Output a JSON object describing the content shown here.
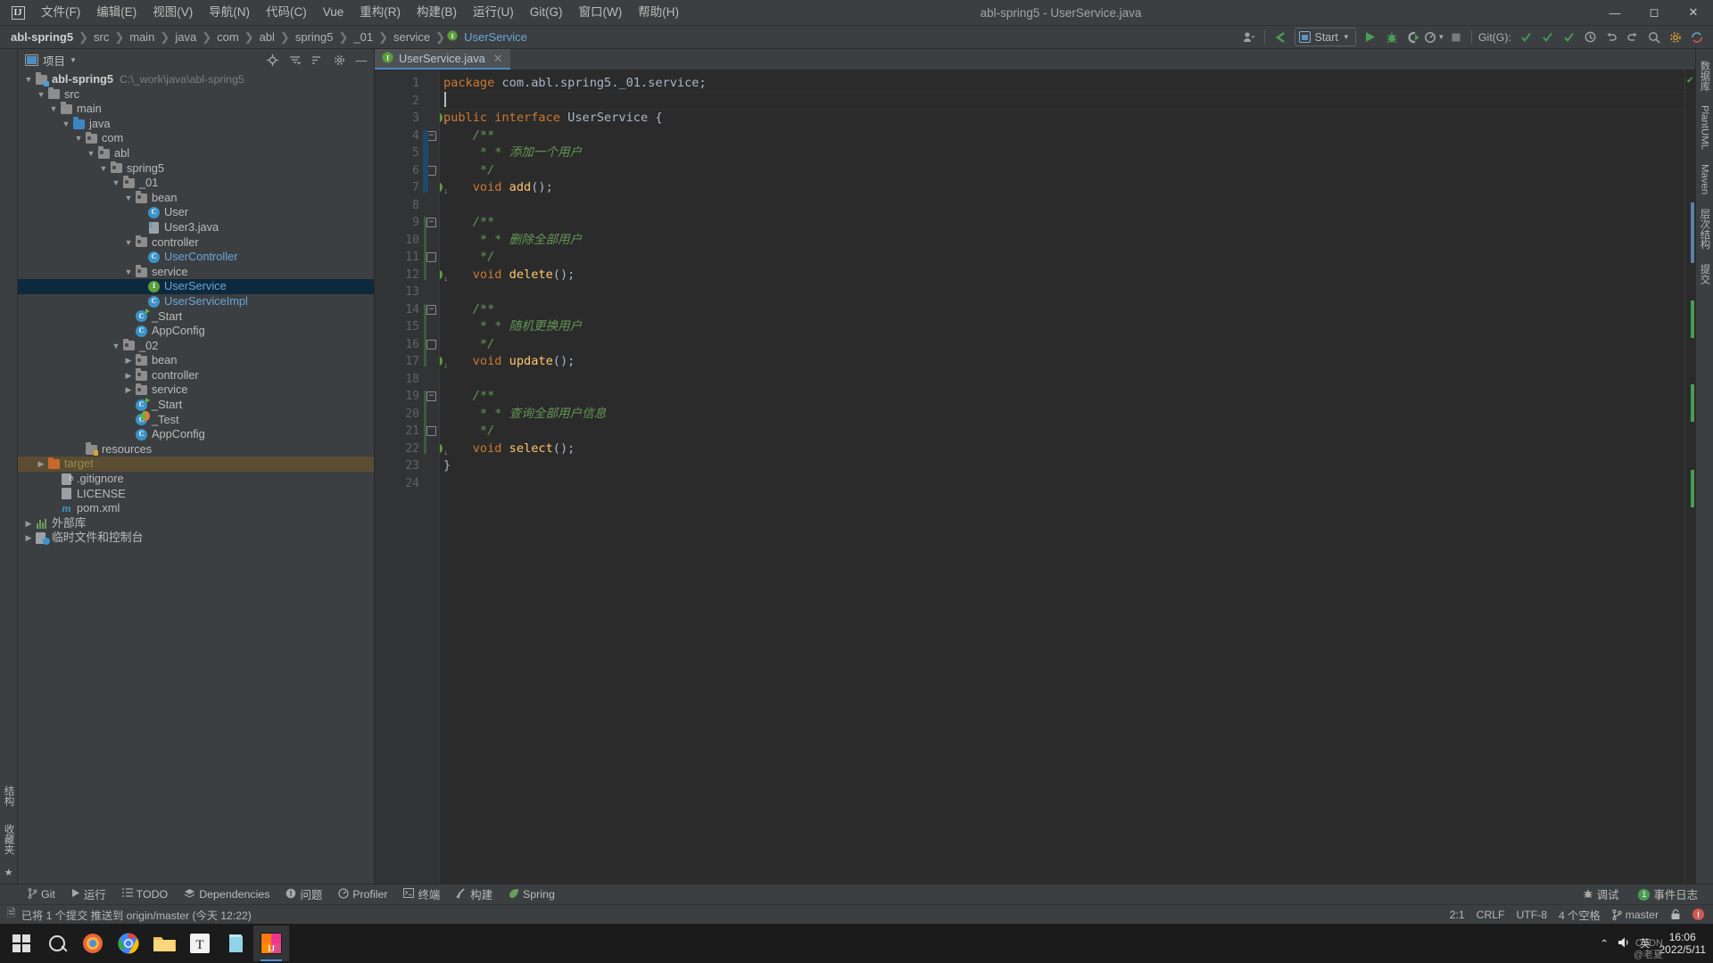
{
  "window": {
    "title": "abl-spring5 - UserService.java",
    "logo": "IJ",
    "controls": [
      "minimize",
      "maximize",
      "close"
    ]
  },
  "menu": {
    "items": [
      {
        "label": "文件(F)",
        "name": "menu-file"
      },
      {
        "label": "编辑(E)",
        "name": "menu-edit"
      },
      {
        "label": "视图(V)",
        "name": "menu-view"
      },
      {
        "label": "导航(N)",
        "name": "menu-navigate"
      },
      {
        "label": "代码(C)",
        "name": "menu-code"
      },
      {
        "label": "Vue",
        "name": "menu-vue"
      },
      {
        "label": "重构(R)",
        "name": "menu-refactor"
      },
      {
        "label": "构建(B)",
        "name": "menu-build"
      },
      {
        "label": "运行(U)",
        "name": "menu-run"
      },
      {
        "label": "Git(G)",
        "name": "menu-git"
      },
      {
        "label": "窗口(W)",
        "name": "menu-window"
      },
      {
        "label": "帮助(H)",
        "name": "menu-help"
      }
    ]
  },
  "breadcrumb": {
    "items": [
      {
        "label": "abl-spring5",
        "bold": true
      },
      {
        "label": "src",
        "bold": false
      },
      {
        "label": "main",
        "bold": false
      },
      {
        "label": "java",
        "bold": false
      },
      {
        "label": "com",
        "bold": false
      },
      {
        "label": "abl",
        "bold": false
      },
      {
        "label": "spring5",
        "bold": false
      },
      {
        "label": "_01",
        "bold": false
      },
      {
        "label": "service",
        "bold": false
      },
      {
        "label": "UserService",
        "bold": false
      }
    ],
    "separator": "❯"
  },
  "toolbar": {
    "run_config": "Start",
    "git_label": "Git(G):",
    "icons": [
      "user-avatar-icon",
      "checkmark-arrow-icon",
      "run-icon",
      "debug-icon",
      "run-with-coverage-icon",
      "profile-icon",
      "stop-icon",
      "git-update-icon",
      "git-commit-icon",
      "git-push-icon",
      "history-icon",
      "undo-icon",
      "redo-icon",
      "search-icon",
      "settings-icon",
      "help-icon"
    ]
  },
  "left_strip": {
    "tabs": [
      {
        "label": "结构",
        "name": "tool-structure",
        "active": false
      },
      {
        "label": "收藏夹",
        "name": "tool-favorites",
        "active": false
      }
    ]
  },
  "project_panel": {
    "title": "项目",
    "header_icons": [
      "locate-icon",
      "collapse-all-icon",
      "sort-icon",
      "settings-icon",
      "hide-icon"
    ],
    "tree": [
      {
        "indent": 0,
        "arrow": "down",
        "icon": "module-folder",
        "label": "abl-spring5",
        "bold": true,
        "hint": "C:\\_work\\java\\abl-spring5"
      },
      {
        "indent": 1,
        "arrow": "down",
        "icon": "folder",
        "label": "src"
      },
      {
        "indent": 2,
        "arrow": "down",
        "icon": "folder",
        "label": "main"
      },
      {
        "indent": 3,
        "arrow": "down",
        "icon": "folder-blue",
        "label": "java"
      },
      {
        "indent": 4,
        "arrow": "down",
        "icon": "package",
        "label": "com"
      },
      {
        "indent": 5,
        "arrow": "down",
        "icon": "package",
        "label": "abl"
      },
      {
        "indent": 6,
        "arrow": "down",
        "icon": "package",
        "label": "spring5"
      },
      {
        "indent": 7,
        "arrow": "down",
        "icon": "package",
        "label": "_01"
      },
      {
        "indent": 8,
        "arrow": "down",
        "icon": "package",
        "label": "bean"
      },
      {
        "indent": 9,
        "arrow": "none",
        "icon": "class",
        "label": "User"
      },
      {
        "indent": 9,
        "arrow": "none",
        "icon": "java-file",
        "label": "User3.java"
      },
      {
        "indent": 8,
        "arrow": "down",
        "icon": "package",
        "label": "controller"
      },
      {
        "indent": 9,
        "arrow": "none",
        "icon": "class",
        "label": "UserController",
        "color": "blue"
      },
      {
        "indent": 8,
        "arrow": "down",
        "icon": "package",
        "label": "service"
      },
      {
        "indent": 9,
        "arrow": "none",
        "icon": "interface",
        "label": "UserService",
        "color": "blue",
        "selected": true
      },
      {
        "indent": 9,
        "arrow": "none",
        "icon": "class",
        "label": "UserServiceImpl",
        "color": "blue"
      },
      {
        "indent": 8,
        "arrow": "none",
        "icon": "class-runnable",
        "label": "_Start"
      },
      {
        "indent": 8,
        "arrow": "none",
        "icon": "class",
        "label": "AppConfig"
      },
      {
        "indent": 7,
        "arrow": "down",
        "icon": "package",
        "label": "_02"
      },
      {
        "indent": 8,
        "arrow": "right",
        "icon": "package",
        "label": "bean"
      },
      {
        "indent": 8,
        "arrow": "right",
        "icon": "package",
        "label": "controller"
      },
      {
        "indent": 8,
        "arrow": "right",
        "icon": "package",
        "label": "service"
      },
      {
        "indent": 8,
        "arrow": "none",
        "icon": "class-runnable",
        "label": "_Start"
      },
      {
        "indent": 8,
        "arrow": "none",
        "icon": "class-test",
        "label": "_Test"
      },
      {
        "indent": 8,
        "arrow": "none",
        "icon": "class",
        "label": "AppConfig"
      },
      {
        "indent": 4,
        "arrow": "none",
        "icon": "folder-resource",
        "label": "resources"
      },
      {
        "indent": 1,
        "arrow": "right",
        "icon": "folder-orange",
        "label": "target",
        "color": "orange",
        "highlight": true
      },
      {
        "indent": 2,
        "arrow": "none",
        "icon": "gitignore-file",
        "label": ".gitignore"
      },
      {
        "indent": 2,
        "arrow": "none",
        "icon": "text-file",
        "label": "LICENSE"
      },
      {
        "indent": 2,
        "arrow": "none",
        "icon": "maven-file",
        "label": "pom.xml"
      },
      {
        "indent": 0,
        "arrow": "right",
        "icon": "library",
        "label": "外部库"
      },
      {
        "indent": 0,
        "arrow": "right",
        "icon": "scratches",
        "label": "临时文件和控制台"
      }
    ]
  },
  "editor": {
    "tab": {
      "label": "UserService.java",
      "icon": "interface-icon",
      "close": "✕"
    },
    "lines": [
      {
        "n": 1,
        "tokens": [
          {
            "t": "package ",
            "c": "kw"
          },
          {
            "t": "com.abl.spring5._01.service;",
            "c": "txt"
          }
        ],
        "gmark": false
      },
      {
        "n": 2,
        "tokens": [],
        "gmark": false,
        "current": true
      },
      {
        "n": 3,
        "tokens": [
          {
            "t": "public interface ",
            "c": "kw"
          },
          {
            "t": "UserService {",
            "c": "txt"
          }
        ],
        "gmark": true
      },
      {
        "n": 4,
        "tokens": [
          {
            "t": "    /**",
            "c": "cmt"
          }
        ],
        "gmark": false,
        "fold": "top",
        "foldsel": true
      },
      {
        "n": 5,
        "tokens": [
          {
            "t": "     * * 添加一个用户",
            "c": "cmt"
          }
        ],
        "gmark": false,
        "foldsel": true
      },
      {
        "n": 6,
        "tokens": [
          {
            "t": "     */",
            "c": "cmt"
          }
        ],
        "gmark": false,
        "fold": "bot",
        "foldsel": true
      },
      {
        "n": 7,
        "tokens": [
          {
            "t": "    void ",
            "c": "kw"
          },
          {
            "t": "add",
            "c": "fn"
          },
          {
            "t": "();",
            "c": "txt"
          }
        ],
        "gmark": true
      },
      {
        "n": 8,
        "tokens": [],
        "gmark": false
      },
      {
        "n": 9,
        "tokens": [
          {
            "t": "    /**",
            "c": "cmt"
          }
        ],
        "gmark": false,
        "fold": "top",
        "foldsel": false
      },
      {
        "n": 10,
        "tokens": [
          {
            "t": "     * * 删除全部用户",
            "c": "cmt"
          }
        ],
        "gmark": false
      },
      {
        "n": 11,
        "tokens": [
          {
            "t": "     */",
            "c": "cmt"
          }
        ],
        "gmark": false,
        "fold": "bot"
      },
      {
        "n": 12,
        "tokens": [
          {
            "t": "    void ",
            "c": "kw"
          },
          {
            "t": "delete",
            "c": "fn"
          },
          {
            "t": "();",
            "c": "txt"
          }
        ],
        "gmark": true
      },
      {
        "n": 13,
        "tokens": [],
        "gmark": false
      },
      {
        "n": 14,
        "tokens": [
          {
            "t": "    /**",
            "c": "cmt"
          }
        ],
        "gmark": false,
        "fold": "top"
      },
      {
        "n": 15,
        "tokens": [
          {
            "t": "     * * 随机更换用户",
            "c": "cmt"
          }
        ],
        "gmark": false
      },
      {
        "n": 16,
        "tokens": [
          {
            "t": "     */",
            "c": "cmt"
          }
        ],
        "gmark": false,
        "fold": "bot"
      },
      {
        "n": 17,
        "tokens": [
          {
            "t": "    void ",
            "c": "kw"
          },
          {
            "t": "update",
            "c": "fn"
          },
          {
            "t": "();",
            "c": "txt"
          }
        ],
        "gmark": true
      },
      {
        "n": 18,
        "tokens": [],
        "gmark": false
      },
      {
        "n": 19,
        "tokens": [
          {
            "t": "    /**",
            "c": "cmt"
          }
        ],
        "gmark": false,
        "fold": "top"
      },
      {
        "n": 20,
        "tokens": [
          {
            "t": "     * * 查询全部用户信息",
            "c": "cmt"
          }
        ],
        "gmark": false
      },
      {
        "n": 21,
        "tokens": [
          {
            "t": "     */",
            "c": "cmt"
          }
        ],
        "gmark": false,
        "fold": "bot"
      },
      {
        "n": 22,
        "tokens": [
          {
            "t": "    void ",
            "c": "kw"
          },
          {
            "t": "select",
            "c": "fn"
          },
          {
            "t": "();",
            "c": "txt"
          }
        ],
        "gmark": true
      },
      {
        "n": 23,
        "tokens": [
          {
            "t": "}",
            "c": "txt"
          }
        ],
        "gmark": false
      },
      {
        "n": 24,
        "tokens": [],
        "gmark": false
      }
    ],
    "inspection_status": "✔"
  },
  "right_strip": {
    "tabs": [
      {
        "label": "数据库",
        "name": "tool-database"
      },
      {
        "label": "PlantUML",
        "name": "tool-plantuml"
      },
      {
        "label": "Maven",
        "name": "tool-maven"
      },
      {
        "label": "层次结构",
        "name": "tool-hierarchy"
      },
      {
        "label": "提交",
        "name": "tool-commit"
      }
    ]
  },
  "bottom_bar": {
    "items": [
      {
        "label": "Git",
        "icon": "git-branch-icon",
        "name": "tool-git"
      },
      {
        "label": "运行",
        "icon": "run-icon",
        "name": "tool-run"
      },
      {
        "label": "TODO",
        "icon": "list-icon",
        "name": "tool-todo"
      },
      {
        "label": "Dependencies",
        "icon": "layers-icon",
        "name": "tool-dependencies"
      },
      {
        "label": "问题",
        "icon": "warning-icon",
        "name": "tool-problems"
      },
      {
        "label": "Profiler",
        "icon": "gauge-icon",
        "name": "tool-profiler"
      },
      {
        "label": "终端",
        "icon": "terminal-icon",
        "name": "tool-terminal"
      },
      {
        "label": "构建",
        "icon": "hammer-icon",
        "name": "tool-build"
      },
      {
        "label": "Spring",
        "icon": "leaf-icon",
        "name": "tool-spring"
      }
    ],
    "right_items": [
      {
        "label": "调试",
        "icon": "bug-icon",
        "name": "tool-debug"
      },
      {
        "label": "事件日志",
        "icon": "event-log-icon",
        "name": "tool-event-log",
        "badge": "1"
      }
    ]
  },
  "status_bar": {
    "message": "已将 1 个提交 推送到 origin/master (今天 12:22)",
    "caret": "2:1",
    "line_sep": "CRLF",
    "encoding": "UTF-8",
    "indent": "4 个空格",
    "branch": "master",
    "lock_icon": "unlocked-icon",
    "error_icon": "error-icon"
  },
  "taskbar": {
    "items": [
      {
        "name": "start-button",
        "icon": "windows-logo"
      },
      {
        "name": "search-button",
        "icon": "search-icon"
      },
      {
        "name": "taskview-button",
        "icon": "chrome-colored-icon"
      },
      {
        "name": "chrome-button",
        "icon": "chrome-icon"
      },
      {
        "name": "explorer-button",
        "icon": "folder-icon"
      },
      {
        "name": "typora-button",
        "icon": "typora-icon"
      },
      {
        "name": "notes-button",
        "icon": "notes-icon"
      },
      {
        "name": "idea-button",
        "icon": "idea-icon",
        "active": true
      }
    ],
    "tray": {
      "chevron": "⌃",
      "volume": "volume-icon",
      "ime": "英",
      "time": "16:06",
      "date": "2022/5/11"
    },
    "watermark_line1": "CSDN",
    "watermark_line2": "@老夏"
  }
}
